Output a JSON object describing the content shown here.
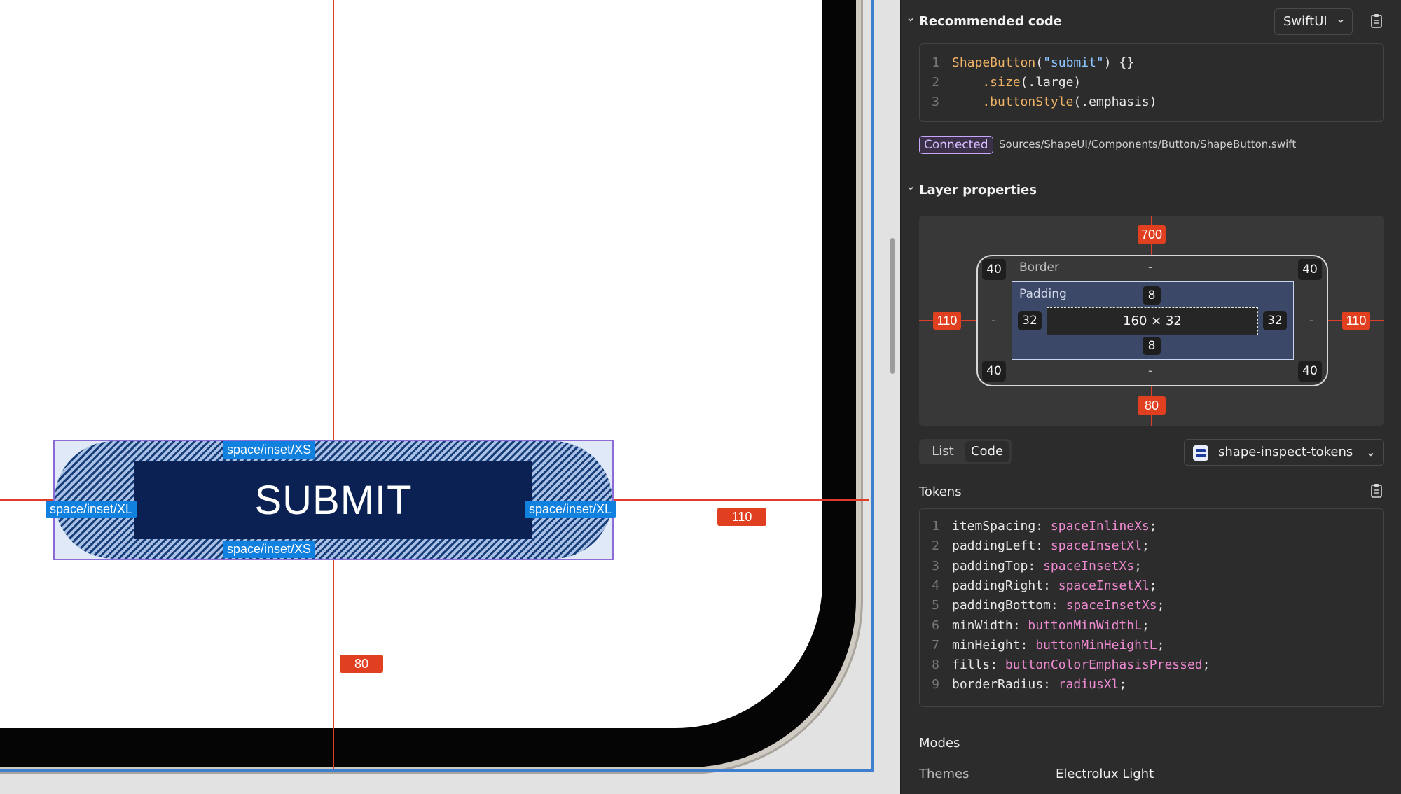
{
  "canvas": {
    "button": {
      "label": "SUBMIT",
      "tags": {
        "top": "space/inset/XS",
        "bottom": "space/inset/XS",
        "left": "space/inset/XL",
        "right": "space/inset/XL"
      }
    },
    "measure_right": "110",
    "measure_bottom": "80"
  },
  "panel": {
    "recommended_code": {
      "title": "Recommended code",
      "framework": "SwiftUI",
      "lines": [
        {
          "num": "1",
          "a": "ShapeButton",
          "b": "(",
          "c": "\"submit\"",
          "d": ") {}"
        },
        {
          "num": "2",
          "a": "    .size",
          "b": "(.large)"
        },
        {
          "num": "3",
          "a": "    .buttonStyle",
          "b": "(.emphasis)"
        }
      ],
      "connected_badge": "Connected",
      "source_path": "Sources/ShapeUI/Components/Button/ShapeButton.swift"
    },
    "layer_properties": {
      "title": "Layer properties",
      "margin_top": "700",
      "margin_left": "110",
      "margin_right": "110",
      "margin_bottom": "80",
      "radius_tl": "40",
      "radius_tr": "40",
      "radius_bl": "40",
      "radius_br": "40",
      "border_label": "Border",
      "border_top": "-",
      "border_left": "-",
      "border_right": "-",
      "border_bottom": "-",
      "padding_label": "Padding",
      "padding_top": "8",
      "padding_bottom": "8",
      "padding_left": "32",
      "padding_right": "32",
      "size": "160 × 32"
    },
    "view_toggle": {
      "list": "List",
      "code": "Code",
      "selected": "Code"
    },
    "library_select": "shape-inspect-tokens",
    "tokens": {
      "title": "Tokens",
      "lines": [
        {
          "num": "1",
          "prop": "itemSpacing",
          "value": "spaceInlineXs"
        },
        {
          "num": "2",
          "prop": "paddingLeft",
          "value": "spaceInsetXl"
        },
        {
          "num": "3",
          "prop": "paddingTop",
          "value": "spaceInsetXs"
        },
        {
          "num": "4",
          "prop": "paddingRight",
          "value": "spaceInsetXl"
        },
        {
          "num": "5",
          "prop": "paddingBottom",
          "value": "spaceInsetXs"
        },
        {
          "num": "6",
          "prop": "minWidth",
          "value": "buttonMinWidthL"
        },
        {
          "num": "7",
          "prop": "minHeight",
          "value": "buttonMinHeightL"
        },
        {
          "num": "8",
          "prop": "fills",
          "value": "buttonColorEmphasisPressed"
        },
        {
          "num": "9",
          "prop": "borderRadius",
          "value": "radiusXl"
        }
      ]
    },
    "modes": {
      "title": "Modes",
      "themes_label": "Themes",
      "themes_value": "Electrolux Light"
    }
  },
  "colors": {
    "redline": "#e03c2a",
    "selection_blue": "#1181e0",
    "button_navy": "#0b2153",
    "connected_purple": "#c9a6ff"
  }
}
